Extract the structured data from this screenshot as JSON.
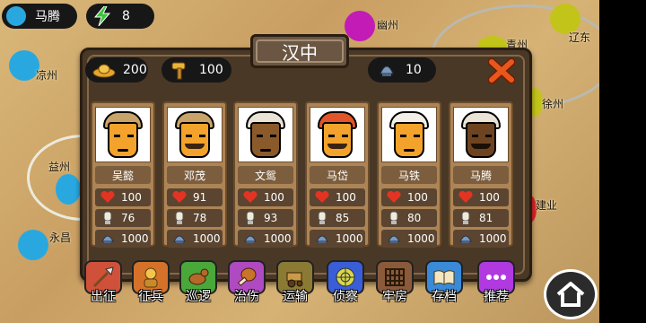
{
  "hud": {
    "player_name": "马腾",
    "player_color": "#29a8e0",
    "energy_value": "8"
  },
  "map_labels": {
    "youzhou": "幽州",
    "qingzhou": "青州",
    "liaodong": "辽东",
    "liangzhou": "凉州",
    "xuzhou": "徐州",
    "yizhou": "益州",
    "jianye": "建业",
    "yongchang": "永昌"
  },
  "panel": {
    "title": "汉中",
    "gold": "200",
    "hammer": "100",
    "troops": "10"
  },
  "generals": [
    {
      "name": "吴懿",
      "hp": "100",
      "attack": "76",
      "soldiers": "1000"
    },
    {
      "name": "邓茂",
      "hp": "91",
      "attack": "78",
      "soldiers": "1000"
    },
    {
      "name": "文鸳",
      "hp": "100",
      "attack": "93",
      "soldiers": "1000"
    },
    {
      "name": "马岱",
      "hp": "100",
      "attack": "85",
      "soldiers": "1000"
    },
    {
      "name": "马铁",
      "hp": "100",
      "attack": "80",
      "soldiers": "1000"
    },
    {
      "name": "马腾",
      "hp": "100",
      "attack": "81",
      "soldiers": "1000"
    }
  ],
  "actions": [
    {
      "label": "出征",
      "icon": "spear-icon"
    },
    {
      "label": "征兵",
      "icon": "recruit-soldier-icon"
    },
    {
      "label": "巡逻",
      "icon": "patrol-horse-icon"
    },
    {
      "label": "治伤",
      "icon": "heal-drumstick-icon"
    },
    {
      "label": "运输",
      "icon": "transport-cart-icon"
    },
    {
      "label": "侦察",
      "icon": "scout-radar-icon"
    },
    {
      "label": "牢房",
      "icon": "jail-bars-icon"
    },
    {
      "label": "存档",
      "icon": "save-book-icon"
    },
    {
      "label": "推荐",
      "icon": "recommend-dots-icon"
    }
  ],
  "colors": {
    "panel_bg": "#4a3826",
    "card_bg": "#ad8456",
    "close_x": "#e8571b",
    "city_purple": "#c21bb6",
    "city_yellow": "#c3c41a",
    "city_blue": "#29a8e0",
    "city_red": "#e0242a"
  }
}
